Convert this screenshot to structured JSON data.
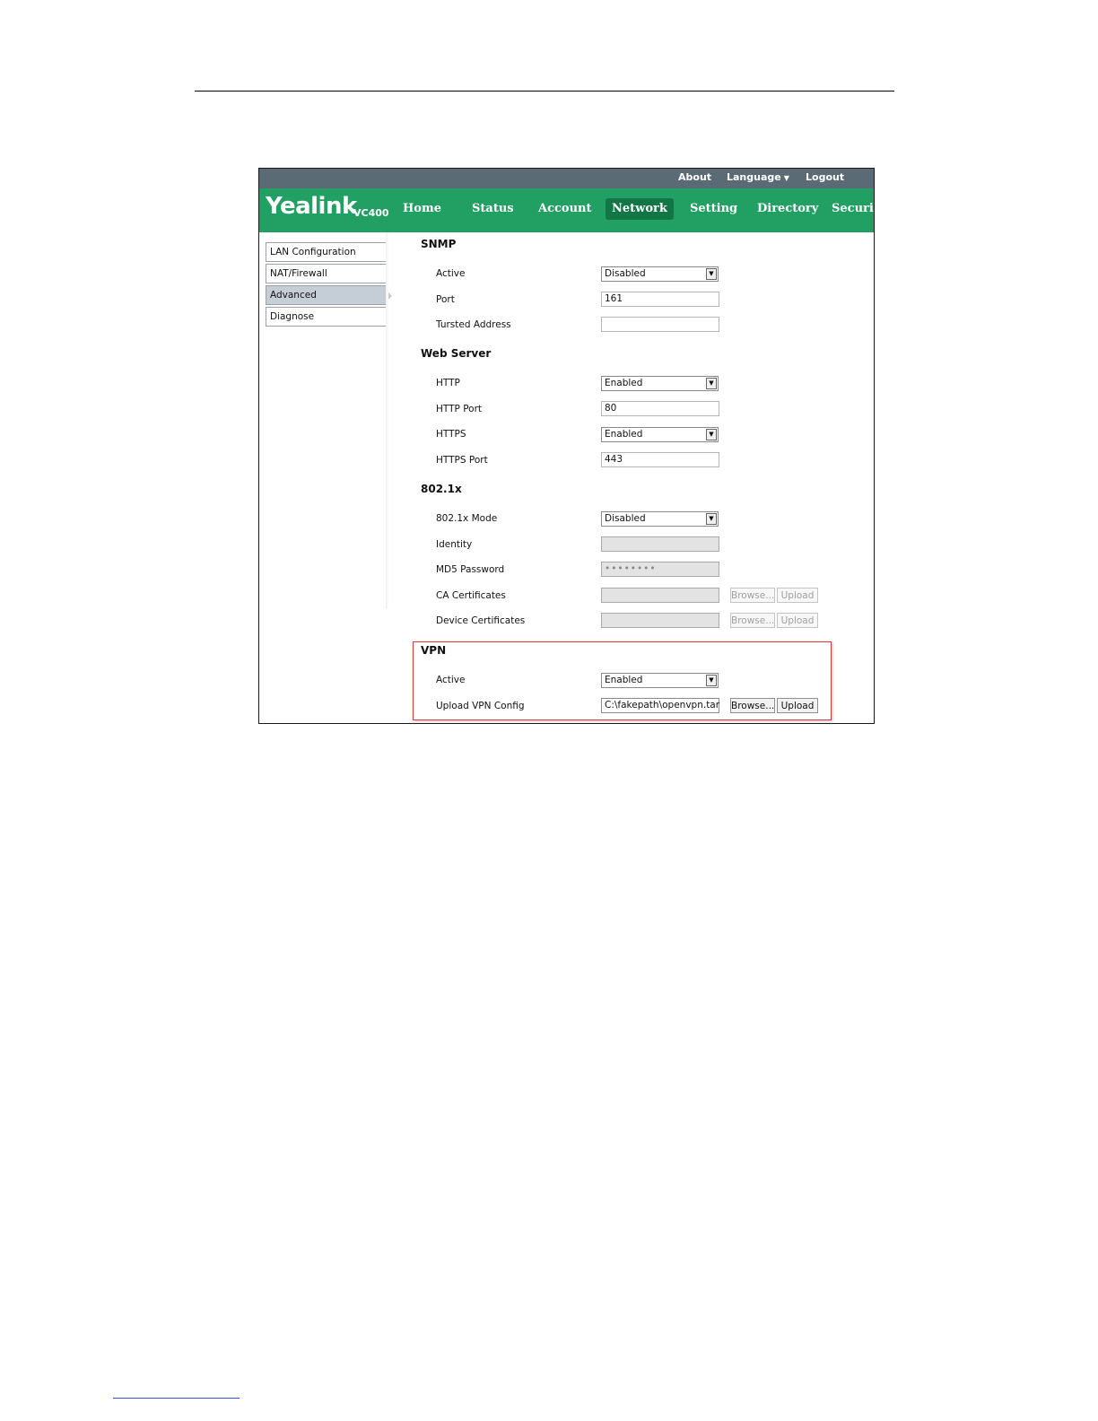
{
  "topbar": {
    "about": "About",
    "language": "Language",
    "logout": "Logout"
  },
  "logo": {
    "brand": "Yealink",
    "model": "VC400"
  },
  "nav": {
    "tabs": [
      {
        "label": "Home"
      },
      {
        "label": "Status"
      },
      {
        "label": "Account"
      },
      {
        "label": "Network",
        "active": true
      },
      {
        "label": "Setting"
      },
      {
        "label": "Directory"
      },
      {
        "label": "Security"
      }
    ]
  },
  "sidebar": {
    "items": [
      {
        "label": "LAN Configuration"
      },
      {
        "label": "NAT/Firewall"
      },
      {
        "label": "Advanced",
        "active": true
      },
      {
        "label": "Diagnose"
      }
    ]
  },
  "snmp": {
    "title": "SNMP",
    "active_label": "Active",
    "active_value": "Disabled",
    "port_label": "Port",
    "port_value": "161",
    "trusted_label": "Tursted Address",
    "trusted_value": ""
  },
  "web": {
    "title": "Web Server",
    "http_label": "HTTP",
    "http_value": "Enabled",
    "http_port_label": "HTTP Port",
    "http_port_value": "80",
    "https_label": "HTTPS",
    "https_value": "Enabled",
    "https_port_label": "HTTPS Port",
    "https_port_value": "443"
  },
  "dot1x": {
    "title": "802.1x",
    "mode_label": "802.1x Mode",
    "mode_value": "Disabled",
    "identity_label": "Identity",
    "identity_value": "",
    "md5_label": "MD5 Password",
    "md5_value": "••••••••",
    "ca_label": "CA Certificates",
    "ca_value": "",
    "device_label": "Device Certificates",
    "device_value": "",
    "browse": "Browse...",
    "upload": "Upload"
  },
  "vpn": {
    "title": "VPN",
    "active_label": "Active",
    "active_value": "Enabled",
    "config_label": "Upload VPN Config",
    "config_value": "C:\\fakepath\\openvpn.tar",
    "browse": "Browse...",
    "upload": "Upload"
  },
  "colors": {
    "topbar": "#5b6b76",
    "navbar": "#22a063",
    "nav_active": "#117545",
    "highlight": "#d93a3a"
  }
}
